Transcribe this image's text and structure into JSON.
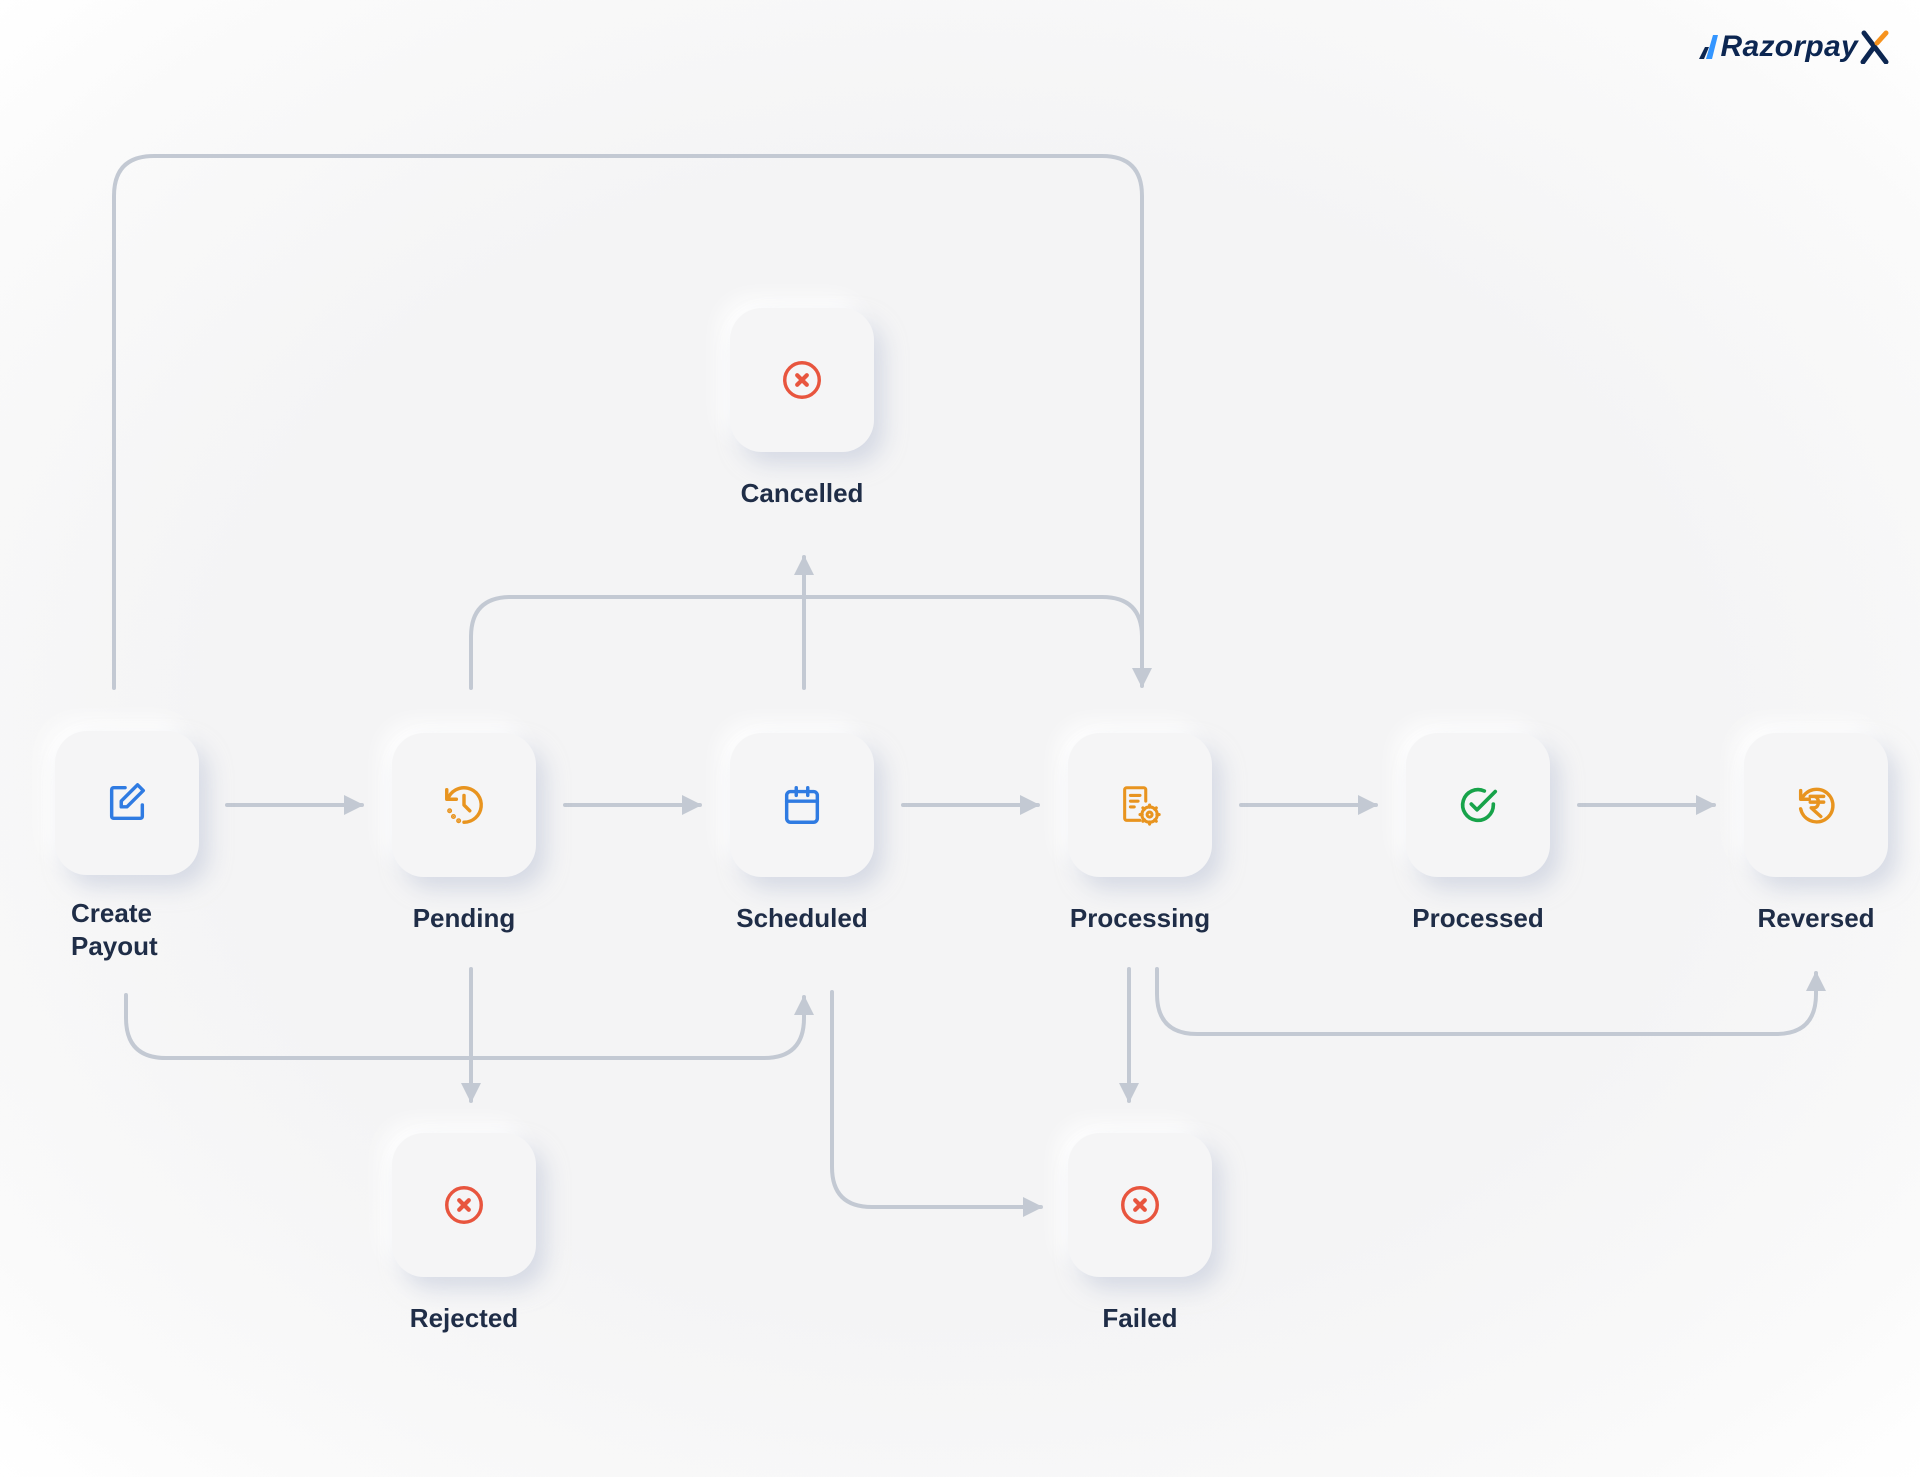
{
  "brand": {
    "name": "Razorpay",
    "suffix": "X",
    "primary_color": "#0c2651",
    "accent_color": "#3395ff",
    "suffix_accent": "#f7931e"
  },
  "colors": {
    "blue": "#2f7be2",
    "orange": "#e8941f",
    "green": "#17a34a",
    "red": "#e8553e",
    "connector": "#c3c9d3",
    "label": "#1f2d47"
  },
  "nodes": [
    {
      "id": "create_payout",
      "label": "Create Payout",
      "icon": "edit-icon",
      "color": "blue"
    },
    {
      "id": "pending",
      "label": "Pending",
      "icon": "history-icon",
      "color": "orange"
    },
    {
      "id": "scheduled",
      "label": "Scheduled",
      "icon": "calendar-icon",
      "color": "blue"
    },
    {
      "id": "processing",
      "label": "Processing",
      "icon": "document-gear-icon",
      "color": "orange"
    },
    {
      "id": "processed",
      "label": "Processed",
      "icon": "check-circle-icon",
      "color": "green"
    },
    {
      "id": "reversed",
      "label": "Reversed",
      "icon": "rupee-refund-icon",
      "color": "orange"
    },
    {
      "id": "cancelled",
      "label": "Cancelled",
      "icon": "x-circle-icon",
      "color": "red"
    },
    {
      "id": "rejected",
      "label": "Rejected",
      "icon": "x-circle-icon",
      "color": "red"
    },
    {
      "id": "failed",
      "label": "Failed",
      "icon": "x-circle-icon",
      "color": "red"
    }
  ],
  "edges": [
    {
      "from": "create_payout",
      "to": "pending"
    },
    {
      "from": "pending",
      "to": "scheduled"
    },
    {
      "from": "scheduled",
      "to": "processing"
    },
    {
      "from": "processing",
      "to": "processed"
    },
    {
      "from": "processed",
      "to": "reversed"
    },
    {
      "from": "create_payout",
      "to": "processing"
    },
    {
      "from": "pending",
      "to": "processing"
    },
    {
      "from": "scheduled",
      "to": "cancelled"
    },
    {
      "from": "create_payout",
      "to": "scheduled"
    },
    {
      "from": "pending",
      "to": "rejected"
    },
    {
      "from": "scheduled",
      "to": "failed"
    },
    {
      "from": "processing",
      "to": "failed"
    },
    {
      "from": "processing",
      "to": "reversed"
    }
  ]
}
